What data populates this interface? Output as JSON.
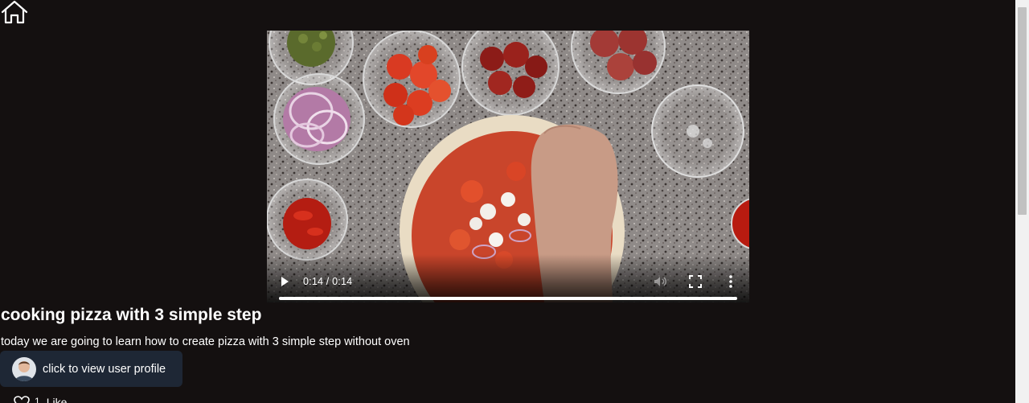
{
  "nav": {
    "home_icon": "home-icon"
  },
  "video": {
    "current_time": "0:14",
    "duration": "0:14",
    "time_display": "0:14 / 0:14",
    "progress_fraction": 1.0,
    "play_icon": "play-icon",
    "mute_icon": "volume-icon",
    "fullscreen_icon": "fullscreen-icon",
    "more_icon": "more-options-icon"
  },
  "post": {
    "title": "cooking pizza with 3 simple step",
    "description": "today we are going to learn how to create pizza with 3 simple step without oven"
  },
  "profile": {
    "button_label": "click to view user profile",
    "avatar_icon": "avatar",
    "background": "#1e2735"
  },
  "likes": {
    "count": "1",
    "label": "Like",
    "icon": "heart-icon"
  },
  "theme": {
    "page_background": "#141010",
    "text": "#ffffff"
  }
}
